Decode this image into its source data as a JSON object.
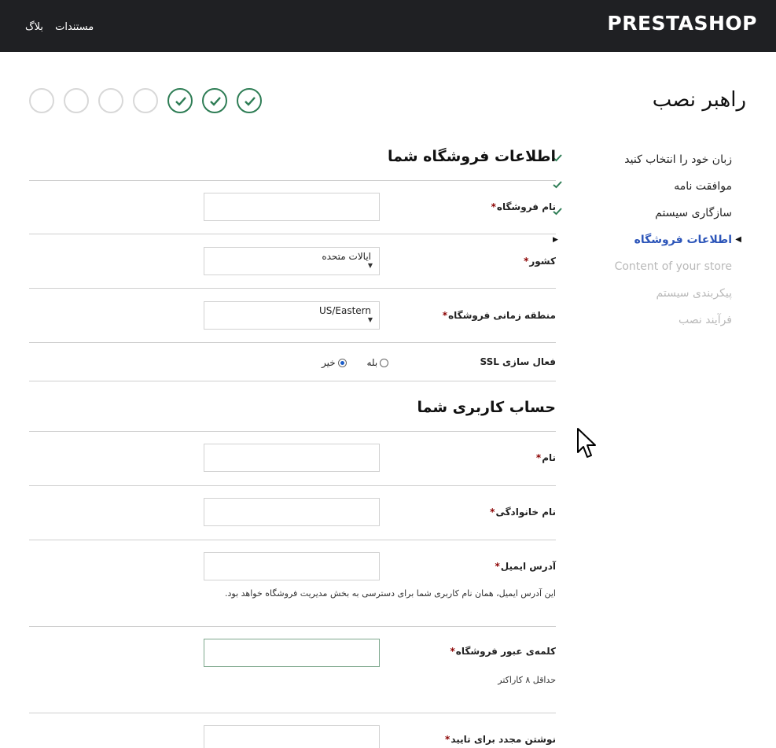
{
  "header": {
    "logo": "PRESTASHOP",
    "links": [
      "مستندات",
      "بلاگ"
    ]
  },
  "page": {
    "title": "راهبر نصب"
  },
  "progress": {
    "completed": 3,
    "total": 7
  },
  "sidebar": {
    "items": [
      {
        "label": "زبان خود را انتخاب کنید",
        "state": "done"
      },
      {
        "label": "موافقت نامه",
        "state": "done"
      },
      {
        "label": "سازگاری سیستم",
        "state": "done"
      },
      {
        "label": "اطلاعات فروشگاه",
        "state": "current"
      },
      {
        "label": "Content of your store",
        "state": "future"
      },
      {
        "label": "پیکربندی سیستم",
        "state": "future"
      },
      {
        "label": "فرآیند نصب",
        "state": "future"
      }
    ]
  },
  "store_section": {
    "title": "اطلاعات فروشگاه شما",
    "store_name_label": "نام فروشگاه",
    "store_name_value": "",
    "country_label": "کشور",
    "country_value": "ایالات متحده",
    "timezone_label": "منطقه زمانی فروشگاه",
    "timezone_value": "US/Eastern",
    "ssl_label": "فعال سازی SSL",
    "ssl_yes": "بله",
    "ssl_no": "خیر",
    "ssl_selected": "no"
  },
  "account_section": {
    "title": "حساب کاربری شما",
    "first_name_label": "نام",
    "first_name_value": "",
    "last_name_label": "نام خانوادگی",
    "last_name_value": "",
    "email_label": "آدرس ایمیل",
    "email_value": "",
    "email_help": "این آدرس ایمیل، همان نام کاربری شما برای دسترسی به بخش مدیریت فروشگاه خواهد بود.",
    "password_label": "کلمه‌ی عبور فروشگاه",
    "password_value": "",
    "password_help": "حداقل ۸ کاراکتر",
    "confirm_label": "نوشتن مجدد برای تایید",
    "confirm_value": ""
  },
  "required_mark": "*",
  "colors": {
    "header_bg": "#1f2023",
    "done_green": "#2e7d55",
    "current_blue": "#2c55b9",
    "required_red": "#8b0000"
  }
}
